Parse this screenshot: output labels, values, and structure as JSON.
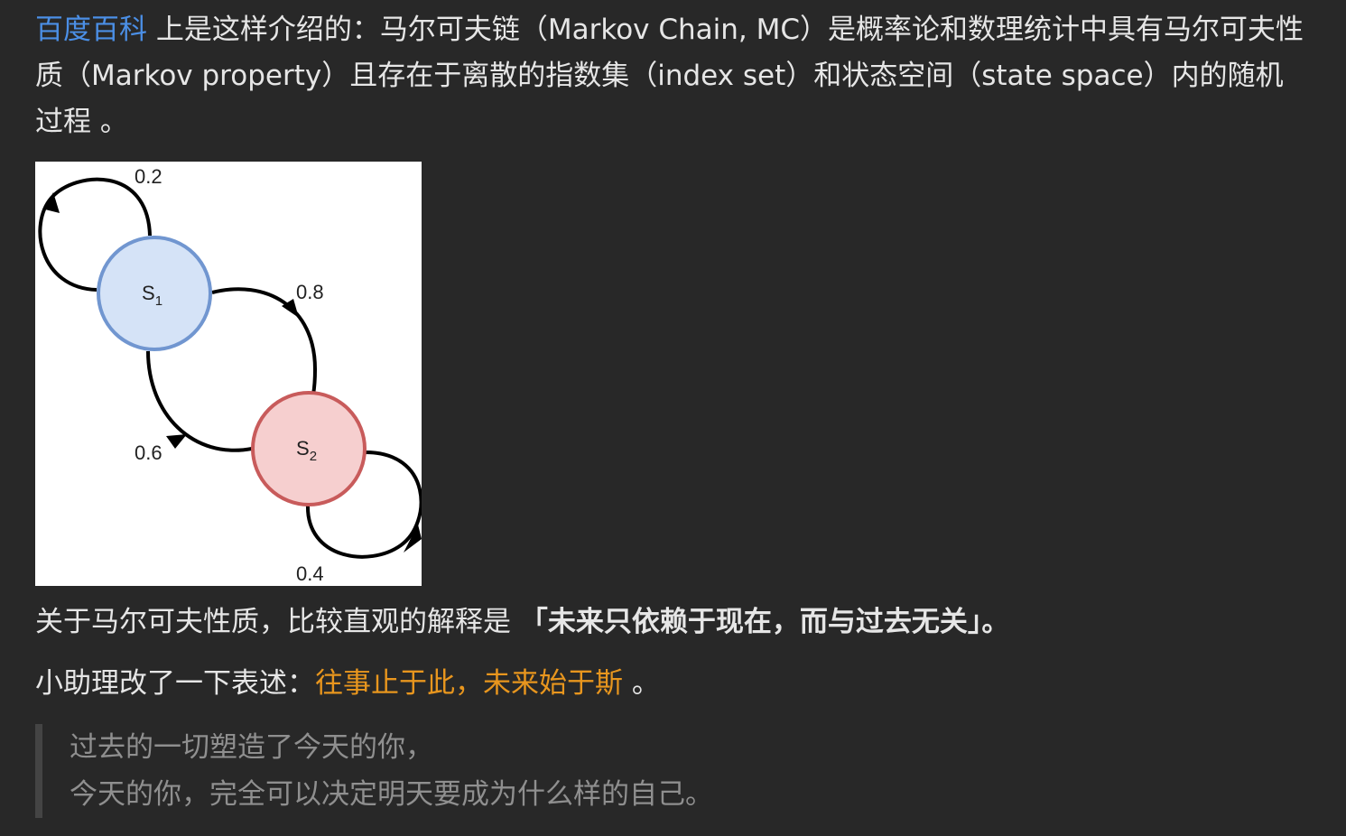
{
  "intro": {
    "link_text": "百度百科",
    "text": " 上是这样介绍的：马尔可夫链（Markov Chain, MC）是概率论和数理统计中具有马尔可夫性质（Markov property）且存在于离散的指数集（index set）和状态空间（state space）内的随机过程 。"
  },
  "diagram": {
    "states": [
      {
        "label": "S",
        "subscript": "1"
      },
      {
        "label": "S",
        "subscript": "2"
      }
    ],
    "transitions": [
      {
        "from": "S1",
        "to": "S1",
        "prob": "0.2"
      },
      {
        "from": "S1",
        "to": "S2",
        "prob": "0.8"
      },
      {
        "from": "S2",
        "to": "S1",
        "prob": "0.6"
      },
      {
        "from": "S2",
        "to": "S2",
        "prob": "0.4"
      }
    ],
    "colors": {
      "s1_fill": "#d5e3f7",
      "s1_stroke": "#7196d0",
      "s2_fill": "#f6cfcf",
      "s2_stroke": "#c85b5b"
    }
  },
  "property": {
    "text": "关于马尔可夫性质，比较直观的解释是 ",
    "bold": "「未来只依赖于现在，而与过去无关」。"
  },
  "assistant": {
    "text": "小助理改了一下表述：",
    "highlight": "往事止于此，未来始于斯",
    "tail": " 。"
  },
  "quote": {
    "line1": "过去的一切塑造了今天的你，",
    "line2": "今天的你，完全可以决定明天要成为什么样的自己。"
  }
}
